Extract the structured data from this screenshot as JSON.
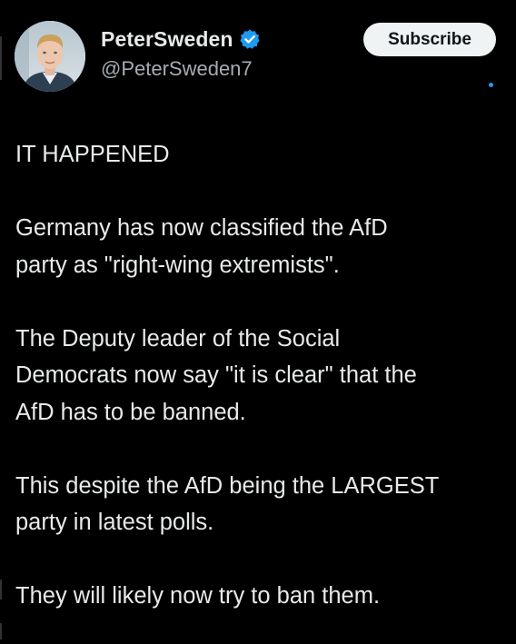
{
  "author": {
    "display_name": "PeterSweden",
    "handle": "@PeterSweden7",
    "verified_icon": "verified-badge-icon"
  },
  "actions": {
    "subscribe_label": "Subscribe"
  },
  "post": {
    "paragraphs": [
      "IT HAPPENED",
      "Germany has now classified the AfD\nparty as \"right-wing extremists\".",
      "The Deputy leader of the Social\nDemocrats now say \"it is clear\" that the\nAfD has to be banned.",
      "This despite the AfD being the LARGEST\nparty in latest polls.",
      "They will likely now try to ban them."
    ]
  },
  "colors": {
    "background": "#000000",
    "text": "#e7e9ea",
    "secondary_text": "#a6acb3",
    "accent": "#1d9bf0",
    "button_bg": "#eff3f4"
  }
}
